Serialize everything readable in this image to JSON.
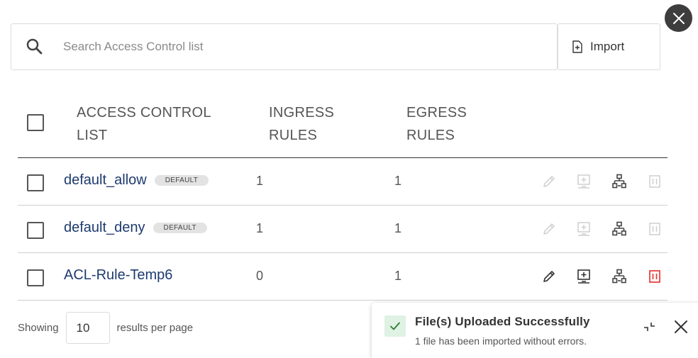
{
  "search": {
    "placeholder": "Search Access Control list",
    "value": ""
  },
  "toolbar": {
    "import_label": "Import"
  },
  "table": {
    "headers": {
      "acl_line1": "ACCESS CONTROL",
      "acl_line2": "LIST",
      "ingress_line1": "INGRESS",
      "ingress_line2": "RULES",
      "egress_line1": "EGRESS",
      "egress_line2": "RULES"
    },
    "rows": [
      {
        "name": "default_allow",
        "badge": "DEFAULT",
        "ingress": "1",
        "egress": "1",
        "actions_enabled": false
      },
      {
        "name": "default_deny",
        "badge": "DEFAULT",
        "ingress": "1",
        "egress": "1",
        "actions_enabled": false
      },
      {
        "name": "ACL-Rule-Temp6",
        "badge": "",
        "ingress": "0",
        "egress": "1",
        "actions_enabled": true
      }
    ]
  },
  "pagination": {
    "showing_label": "Showing",
    "page_size": "10",
    "suffix_label": "results per page"
  },
  "toast": {
    "title": "File(s) Uploaded Successfully",
    "message": "1 file has been imported without errors."
  },
  "colors": {
    "link": "#1e3a6e",
    "delete_red": "#e53935",
    "success_bg": "#dff2e4",
    "success_check": "#2e7d32",
    "disabled_icon": "#c8c8c8"
  },
  "icons": {
    "close_modal": "close-icon",
    "search": "search-icon",
    "import": "file-import-icon",
    "edit": "pencil-icon",
    "export": "monitor-download-icon",
    "network": "network-icon",
    "delete": "trash-icon",
    "success": "check-icon",
    "collapse": "minimize-icon",
    "toast_close": "close-icon"
  }
}
